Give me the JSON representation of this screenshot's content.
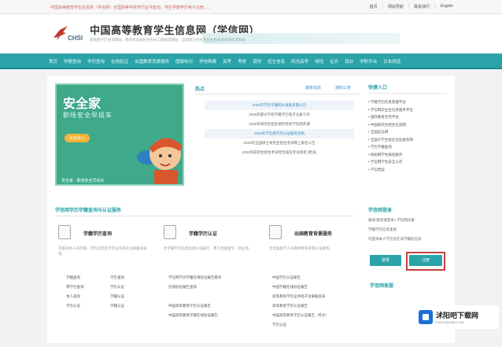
{
  "topbar": {
    "notice": "中国高等教育学生信息网（学信网）全国高等学校学历证书查询、学生学籍学历电子注册……",
    "links": [
      "首页",
      "网站导航",
      "联系我们",
      "English"
    ]
  },
  "header": {
    "logo_text": "CHSI",
    "title": "中国高等教育学生信息网（学信网）",
    "subtitle": "教育部学历查询网站、教育部高校招生阳光工程指定网站、全国硕士研究生招生报名和调剂指定网站"
  },
  "nav": {
    "items": [
      "首页",
      "学籍查询",
      "学历查询",
      "在线验证",
      "出国教育背景服务",
      "图像校对",
      "学信档案",
      "高考",
      "考研",
      "调剂",
      "招生信息",
      "阳光高考",
      "研招",
      "征兵",
      "就业",
      "学职平台",
      "日本频道"
    ]
  },
  "promo": {
    "title": "安全家",
    "subtitle": "职场安全早班车",
    "button": "点击进入",
    "footer": "安全家 · 职场安全早班车"
  },
  "news": {
    "title": "热点",
    "tabs": [
      "最新动态",
      "通知公告"
    ],
    "items": [
      "2020年学历学籍照片采集日期公告",
      "2020年部分学校学籍学历电子注册工作",
      "2020年研究生招生调剂系统学信网开通",
      "2020年学信网学历认证服务说明",
      "2020年全国硕士研究生招生考试网上报名公告",
      "2020年研究生招生考试考生诚信考试承诺 [更多]"
    ]
  },
  "quick": {
    "title": "快捷入口",
    "items": [
      "学籍学历信息管理平台",
      "学信网毕业生信息服务平台",
      "国际教育合作平台",
      "中国研究生招生信息网",
      "全国征兵网",
      "全国大学生就业创业服务网",
      "学历学籍查询",
      "研招网学生报名服务",
      "学信网学生安全公司",
      "学信档案"
    ]
  },
  "services": {
    "title": "学信网学历学籍查询与认证服务",
    "columns": [
      {
        "heading": "学籍学历查询",
        "desc": "可查询本人的学籍、学历信息及学历证书电子注册备案表等。",
        "links": [
          "学籍查询",
          "学历查询",
          "零学历查询",
          "学历认证",
          "本人查询",
          "学籍认证",
          "学历认证",
          "学籍认证"
        ]
      },
      {
        "heading": "学籍学历认证",
        "desc": "为学籍学历信息出具认证报告，用于出国留学、就业等。",
        "links": [
          "学信网学历学籍在线验证报告服务",
          "在线验证报告查询",
          "中国高等教育学历认证报告",
          "中国高等教育学籍在线验证报告"
        ]
      },
      {
        "heading": "出国教育背景服务",
        "desc": "为出国留学人员提供教育背景认证服务。",
        "links": [
          "中国学历认证报告",
          "中国学籍在线验证报告",
          "高等教育学历证书电子注册备案表",
          "高等教育学历认证报告",
          "中国高等教育学历认证报告（英文）",
          "学历认证"
        ]
      }
    ]
  },
  "login": {
    "title": "学信网登录",
    "rows": [
      "报名/查询请登录 | 学信网注册",
      "学籍学历信息查询",
      "可查询本人学历及在读学籍的信息"
    ],
    "login_button": "登录",
    "register_button": "注册",
    "section2": "学信网客服"
  },
  "watermark": {
    "brand": "沭阳吧下载网",
    "url": "SHUYANGBA.COM"
  }
}
